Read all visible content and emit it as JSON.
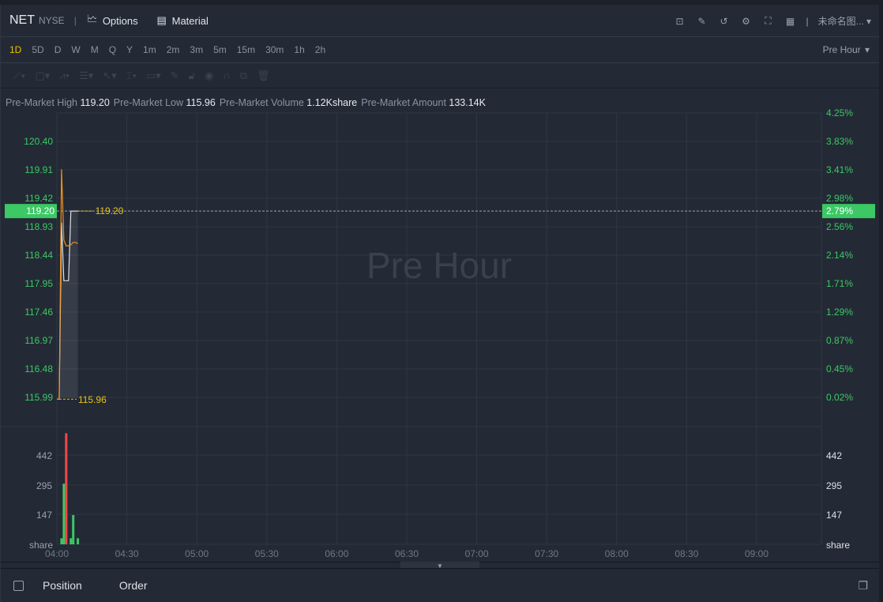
{
  "header": {
    "symbol": "NET",
    "exchange": "NYSE",
    "options": "Options",
    "material": "Material",
    "layout_name": "未命名图..."
  },
  "periods": {
    "items": [
      "1D",
      "5D",
      "D",
      "W",
      "M",
      "Q",
      "Y",
      "1m",
      "2m",
      "3m",
      "5m",
      "15m",
      "30m",
      "1h",
      "2h"
    ],
    "active": "1D",
    "session": "Pre Hour"
  },
  "stats": [
    {
      "label": "Pre-Market High",
      "value": "119.20"
    },
    {
      "label": "Pre-Market Low",
      "value": "115.96"
    },
    {
      "label": "Pre-Market Volume",
      "value": "1.12Kshare"
    },
    {
      "label": "Pre-Market Amount",
      "value": "133.14K"
    }
  ],
  "watermark": "Pre Hour",
  "colors": {
    "up": "#3cc864",
    "down": "#f04848",
    "avg": "#f0901c",
    "price": "#e0e0e0",
    "marker": "#e6c21a"
  },
  "chart_data": {
    "type": "line",
    "price_ticks": [
      "120.40",
      "119.91",
      "119.42",
      "118.93",
      "118.44",
      "117.95",
      "117.46",
      "116.97",
      "116.48",
      "115.99"
    ],
    "pct_ticks": [
      "4.25%",
      "3.83%",
      "3.41%",
      "2.98%",
      "2.56%",
      "2.14%",
      "1.71%",
      "1.29%",
      "0.87%",
      "0.45%",
      "0.02%"
    ],
    "time_ticks": [
      "04:00",
      "04:30",
      "05:00",
      "05:30",
      "06:00",
      "06:30",
      "07:00",
      "07:30",
      "08:00",
      "08:30",
      "09:00"
    ],
    "current_price": "119.20",
    "current_pct": "2.79%",
    "high_label": "119.20",
    "low_label": "115.96",
    "price_series": {
      "minutes": [
        1,
        2,
        3,
        4,
        5,
        6,
        7,
        8,
        9
      ],
      "values": [
        115.96,
        119.0,
        118.0,
        118.0,
        118.0,
        119.2,
        119.2,
        119.2,
        119.2
      ]
    },
    "avg_series": {
      "minutes": [
        1,
        2,
        3,
        4,
        5,
        6,
        7,
        8,
        9
      ],
      "values": [
        115.96,
        119.92,
        118.7,
        118.6,
        118.6,
        118.62,
        118.66,
        118.66,
        118.64
      ]
    },
    "volume_ticks": [
      "442",
      "295",
      "147"
    ],
    "volume_unit": "share",
    "volume": [
      {
        "minute": 2,
        "value": 30,
        "dir": "up"
      },
      {
        "minute": 3,
        "value": 300,
        "dir": "up"
      },
      {
        "minute": 4,
        "value": 550,
        "dir": "down"
      },
      {
        "minute": 6,
        "value": 30,
        "dir": "up"
      },
      {
        "minute": 7,
        "value": 145,
        "dir": "up"
      },
      {
        "minute": 9,
        "value": 30,
        "dir": "up"
      }
    ]
  },
  "bottom": {
    "position": "Position",
    "order": "Order"
  }
}
